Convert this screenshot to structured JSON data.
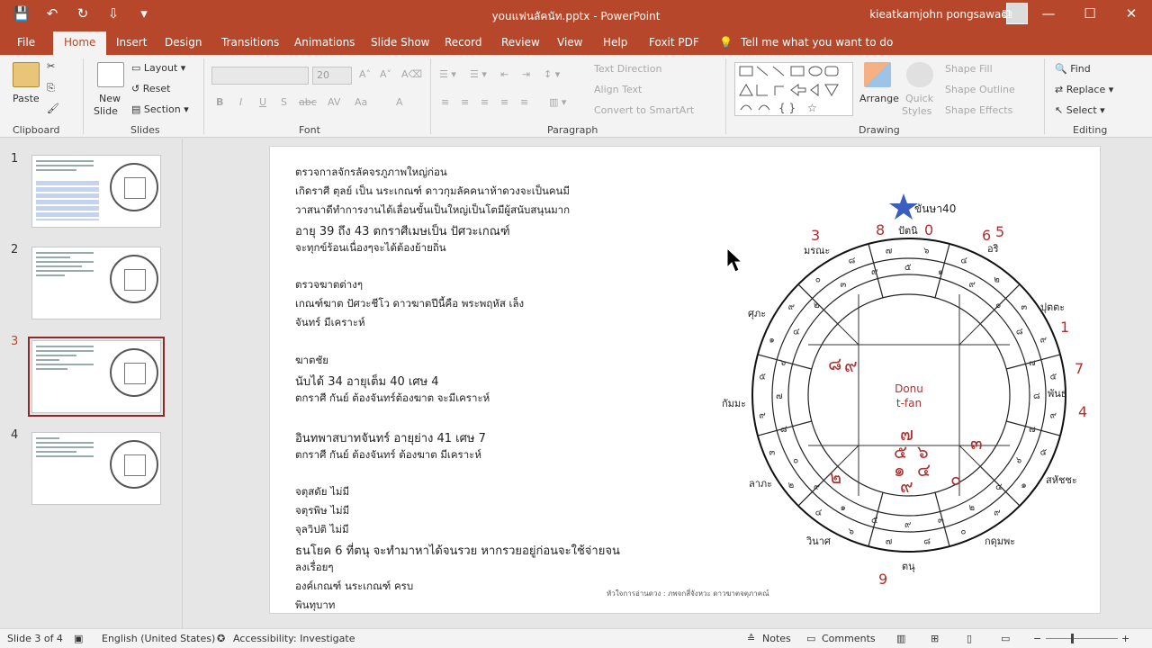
{
  "window": {
    "title": "youแฟนลัคนัท.pptx  -  PowerPoint",
    "user": "kieatkamjohn pongsawad",
    "qat": [
      "💾",
      "↶",
      "↻",
      "⇩",
      "▾"
    ],
    "controls": [
      "⧉",
      "—",
      "☐",
      "✕"
    ]
  },
  "tabs": [
    "File",
    "Home",
    "Insert",
    "Design",
    "Transitions",
    "Animations",
    "Slide Show",
    "Record",
    "Review",
    "View",
    "Help",
    "Foxit PDF"
  ],
  "tell_me": "Tell me what you want to do",
  "ribbon": {
    "clipboard": {
      "paste": "Paste",
      "label": "Clipboard"
    },
    "slides": {
      "new_slide": "New",
      "new_slide2": "Slide",
      "layout": "Layout",
      "reset": "Reset",
      "section": "Section",
      "label": "Slides"
    },
    "font": {
      "size": "20",
      "label": "Font",
      "buttons": [
        "B",
        "I",
        "U",
        "S",
        "abc",
        "AV",
        "Aa",
        "A"
      ]
    },
    "paragraph": {
      "text_direction": "Text Direction",
      "align_text": "Align Text",
      "convert": "Convert to SmartArt",
      "label": "Paragraph"
    },
    "drawing": {
      "arrange": "Arrange",
      "quick_styles": "Quick",
      "quick_styles2": "Styles",
      "shape_fill": "Shape Fill",
      "shape_outline": "Shape Outline",
      "shape_effects": "Shape Effects",
      "label": "Drawing"
    },
    "editing": {
      "find": "Find",
      "replace": "Replace",
      "select": "Select",
      "label": "Editing"
    }
  },
  "thumbnails": [
    {
      "number": "1",
      "has_table": true
    },
    {
      "number": "2",
      "has_table": false
    },
    {
      "number": "3",
      "has_table": false
    },
    {
      "number": "4",
      "has_table": false
    }
  ],
  "slide": {
    "lines": [
      "ตรวจกาลจักรลัคจรภูภาพใหญ่ก่อน",
      "เกิดราศี  ตุลย์   เป็น  นระเกณฑ์  ดาวกุมลัคคนาห้าดวงจะเป็นคนมี",
      "วาสนาดีทำการงานได้เลื่อนขั้นเป็นใหญ่เป็นโตมีผู้สนับสนุนมาก",
      "อายุ 39  ถึง 43  ตกราศีเมษเป็น ปัศวะเกณฑ์",
      "จะทุกข์ร้อนเนื่องๆจะได้ต้องย้ายถิ่น",
      "",
      "ตรวจฆาตต่างๆ",
      "เกณฑ์ฆาต    ปัศวะชีโว       ดาวฆาตปีนี้คือ    พระพฤหัส  เล็ง",
      "จันทร์ มีเคราะห์",
      "",
      "ฆาตชัย",
      "นับได้   34 อายุเต็ม 40 เศษ 4",
      "ตกราศี กันย์   ต้องจันทร์ต้องฆาต จะมีเคราะห์",
      "",
      "อินทพาสบาทจันทร์  อายุย่าง  41 เศษ 7",
      "ตกราศี กันย์ ต้องจันทร์ ต้องฆาต มีเคราะห์",
      "",
      "จตุสดัย     ไม่มี",
      "จตุรพิษ    ไม่มี",
      "จุลวิปติ         ไม่มี",
      "ธนโยค    6 ที่ตนุ  จะทำมาหาได้จนรวย หากรวยอยู่ก่อนจะใช้จ่ายจน",
      "ลงเรื่อยๆ",
      "องค์เกณฑ์  นระเกณฑ์ ครบ",
      "พินทุบาท"
    ],
    "caption": "หัวใจการอ่านดวง : ภพจกสี่จังหวะ ดาวฆาตจตุภาคณ์",
    "chart": {
      "center_label_1": "Donu",
      "center_label_2": "t-fan",
      "star_label": "ขันษา40",
      "house_names": [
        "ปัตนิ",
        "อริ",
        "ปุตตะ",
        "พันธุ",
        "สหัชชะ",
        "กดุมพะ",
        "ตนุ",
        "วินาศ",
        "ลาภะ",
        "กัมมะ",
        "ศุภะ",
        "มรณะ"
      ],
      "red_numbers": [
        "8",
        "0",
        "6",
        "5",
        "1",
        "7",
        "4",
        "9",
        "3"
      ],
      "inner_digits": [
        "๘",
        "๙",
        "๗",
        "๕",
        "๖",
        "๑",
        "๔",
        "๙",
        "๒",
        "๐",
        "๓"
      ]
    }
  },
  "status": {
    "slide": "Slide 3 of 4",
    "lang": "English (United States)",
    "access": "Accessibility: Investigate",
    "notes": "Notes",
    "comments": "Comments"
  }
}
